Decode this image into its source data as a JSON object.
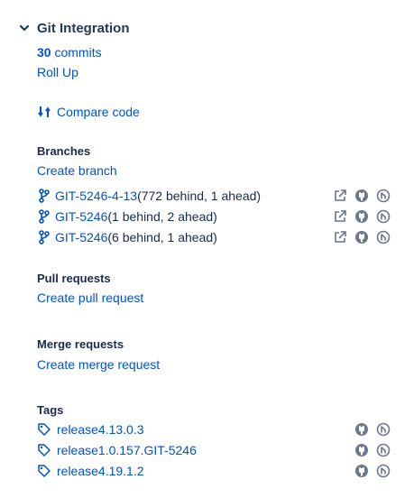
{
  "header": {
    "title": "Git Integration"
  },
  "summary": {
    "commit_count": "30",
    "commit_suffix": " commits",
    "roll_up": "Roll Up"
  },
  "compare_code": "Compare code",
  "branches": {
    "title": "Branches",
    "create": "Create branch",
    "items": [
      {
        "name": "GIT-5246-4-13",
        "status": " (772 behind, 1 ahead)"
      },
      {
        "name": "GIT-5246",
        "status": " (1 behind, 2 ahead)"
      },
      {
        "name": "GIT-5246",
        "status": " (6 behind, 1 ahead)"
      }
    ]
  },
  "pull_requests": {
    "title": "Pull requests",
    "create": "Create pull request"
  },
  "merge_requests": {
    "title": "Merge requests",
    "create": "Create merge request"
  },
  "tags": {
    "title": "Tags",
    "items": [
      {
        "name": "release4.13.0.3"
      },
      {
        "name": "release1.0.157.GIT-5246"
      },
      {
        "name": "release4.19.1.2"
      }
    ]
  },
  "colors": {
    "link": "#0052cc",
    "text": "#172b4d",
    "icon_gray": "#6b778c"
  }
}
